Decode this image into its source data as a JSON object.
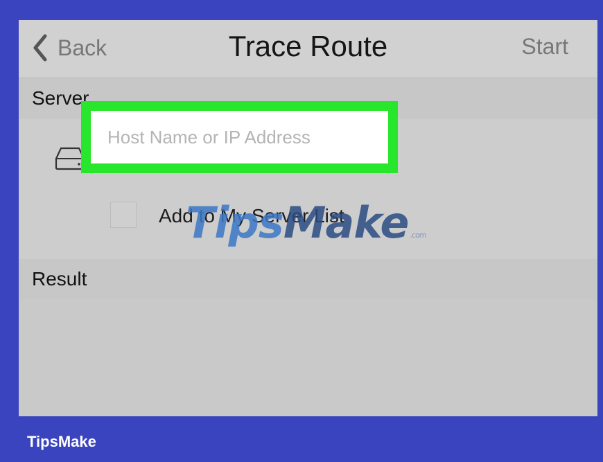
{
  "navbar": {
    "back_label": "Back",
    "title": "Trace Route",
    "start_label": "Start"
  },
  "server_section": {
    "header": "Server",
    "host_input": {
      "value": "",
      "placeholder": "Host Name or IP Address"
    },
    "add_to_list": {
      "label": "Add to My Server List",
      "checked": false
    }
  },
  "result_section": {
    "header": "Result"
  },
  "watermark": {
    "text_main": "Tips",
    "text_tail": "Make",
    "text_small": ".com"
  },
  "footer": {
    "brand": "TipsMake"
  },
  "colors": {
    "frame_blue": "#3b44bf",
    "highlight_green": "#27e62b",
    "screen_gray": "#c9c9c9"
  },
  "icons": [
    "chevron-left-icon",
    "hard-drive-icon"
  ]
}
